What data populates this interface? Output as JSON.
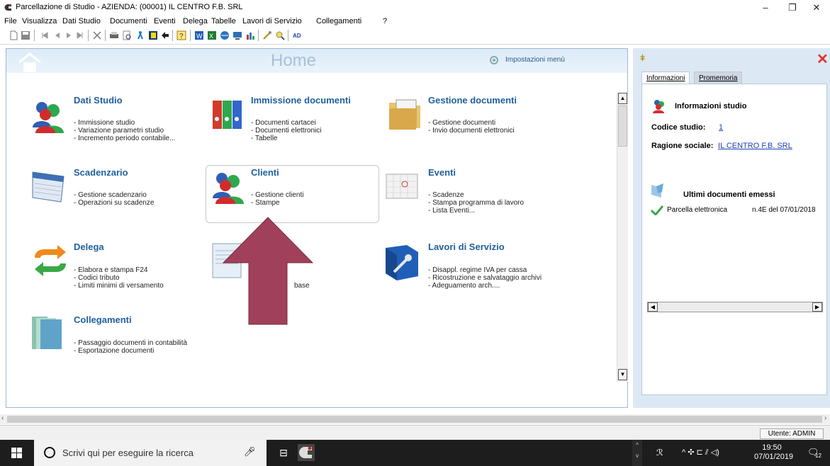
{
  "window": {
    "title": "Parcellazione di Studio - AZIENDA: (00001) IL CENTRO F.B. SRL",
    "minimize": "–",
    "maximize": "❐",
    "close": "✕"
  },
  "menu": [
    "File",
    "Visualizza",
    "Dati Studio",
    "Documenti",
    "Eventi",
    "Delega",
    "Tabelle",
    "Lavori di Servizio",
    "Collegamenti",
    "?"
  ],
  "home": {
    "title": "Home",
    "settings_label": "Impostazioni menù",
    "items": [
      {
        "heading": "Dati Studio",
        "lines": [
          "- Immissione studio",
          "- Variazione parametri studio",
          "- Incremento periodo contabile..."
        ]
      },
      {
        "heading": "Immissione documenti",
        "lines": [
          "- Documenti cartacei",
          "- Documenti elettronici",
          "- Tabelle"
        ]
      },
      {
        "heading": "Gestione documenti",
        "lines": [
          "- Gestione documenti",
          "- Invio documenti elettronici"
        ]
      },
      {
        "heading": "Scadenzario",
        "lines": [
          "- Gestione scadenzario",
          "- Operazioni su scadenze"
        ]
      },
      {
        "heading": "Clienti",
        "lines": [
          "- Gestione clienti",
          "- Stampe"
        ]
      },
      {
        "heading": "Eventi",
        "lines": [
          "- Scadenze",
          "- Stampa programma di lavoro",
          "- Lista Eventi..."
        ]
      },
      {
        "heading": "Delega",
        "lines": [
          "- Elabora e stampa F24",
          "- Codici tributo",
          "- Limiti minimi di versamento"
        ]
      },
      {
        "heading": "",
        "lines": [
          "base"
        ]
      },
      {
        "heading": "Lavori di Servizio",
        "lines": [
          "- Disappl. regime IVA per cassa",
          "- Ricostruzione e salvataggio archivi",
          "- Adeguamento arch...."
        ]
      },
      {
        "heading": "Collegamenti",
        "lines": [
          "- Passaggio documenti in contabilità",
          "- Esportazione documenti"
        ]
      }
    ]
  },
  "panel": {
    "tabs": [
      "Informazioni",
      "Promemoria"
    ],
    "info_title": "Informazioni studio",
    "codice_label": "Codice studio:",
    "codice_value": "1",
    "ragione_label": "Ragione sociale:",
    "ragione_value": "IL CENTRO F.B. SRL",
    "docs_title": "Ultimi documenti emessi",
    "doc_name": "Parcella elettronica",
    "doc_info": "n.4E del 07/01/2018"
  },
  "status": {
    "user": "Utente: ADMIN"
  },
  "taskbar": {
    "search_placeholder": "Scrivi qui per eseguire la ricerca",
    "time": "19:50",
    "date": "07/01/2019",
    "notif_count": "12",
    "keyboard": "ℛ"
  },
  "colors": {
    "heading": "#1f5f9c",
    "arrow": "#a0405a",
    "panel_bg": "#dce9f5",
    "close_red": "#e0332a"
  }
}
